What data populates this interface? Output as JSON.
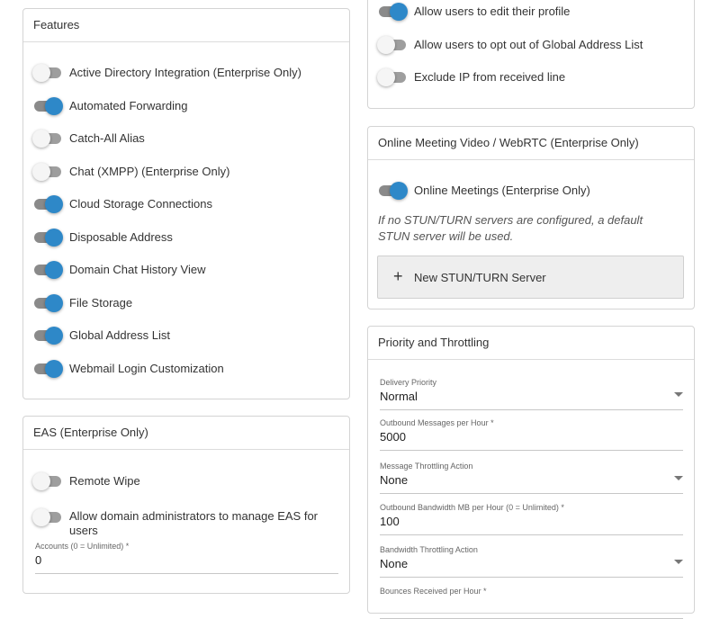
{
  "colors": {
    "toggle_on": "#2e88c8",
    "border": "#d4d4d4"
  },
  "features": {
    "title": "Features",
    "items": [
      {
        "label": "Active Directory Integration (Enterprise Only)",
        "on": false
      },
      {
        "label": "Automated Forwarding",
        "on": true
      },
      {
        "label": "Catch-All Alias",
        "on": false
      },
      {
        "label": "Chat (XMPP) (Enterprise Only)",
        "on": false
      },
      {
        "label": "Cloud Storage Connections",
        "on": true
      },
      {
        "label": "Disposable Address",
        "on": true
      },
      {
        "label": "Domain Chat History View",
        "on": true
      },
      {
        "label": "File Storage",
        "on": true
      },
      {
        "label": "Global Address List",
        "on": true
      },
      {
        "label": "Webmail Login Customization",
        "on": true
      }
    ]
  },
  "eas": {
    "title": "EAS (Enterprise Only)",
    "items": [
      {
        "label": "Remote Wipe",
        "on": false
      },
      {
        "label": "Allow domain administrators to manage EAS for users",
        "on": false
      }
    ],
    "accounts_label": "Accounts (0 = Unlimited) *",
    "accounts_value": "0"
  },
  "user_options": {
    "items": [
      {
        "label": "Allow users to edit their profile",
        "on": true
      },
      {
        "label": "Allow users to opt out of Global Address List",
        "on": false
      },
      {
        "label": "Exclude IP from received line",
        "on": false
      }
    ]
  },
  "online_meeting": {
    "title": "Online Meeting Video / WebRTC (Enterprise Only)",
    "toggle": {
      "label": "Online Meetings (Enterprise Only)",
      "on": true
    },
    "note": "If no STUN/TURN servers are configured, a default STUN server will be used.",
    "new_server_label": "New STUN/TURN Server",
    "new_server_icon": "plus-icon"
  },
  "priority": {
    "title": "Priority and Throttling",
    "fields": [
      {
        "label": "Delivery Priority",
        "value": "Normal",
        "dropdown": true
      },
      {
        "label": "Outbound Messages per Hour *",
        "value": "5000",
        "dropdown": false
      },
      {
        "label": "Message Throttling Action",
        "value": "None",
        "dropdown": true
      },
      {
        "label": "Outbound Bandwidth MB per Hour (0 = Unlimited) *",
        "value": "100",
        "dropdown": false
      },
      {
        "label": "Bandwidth Throttling Action",
        "value": "None",
        "dropdown": true
      },
      {
        "label": "Bounces Received per Hour *",
        "value": "",
        "dropdown": false
      }
    ]
  }
}
